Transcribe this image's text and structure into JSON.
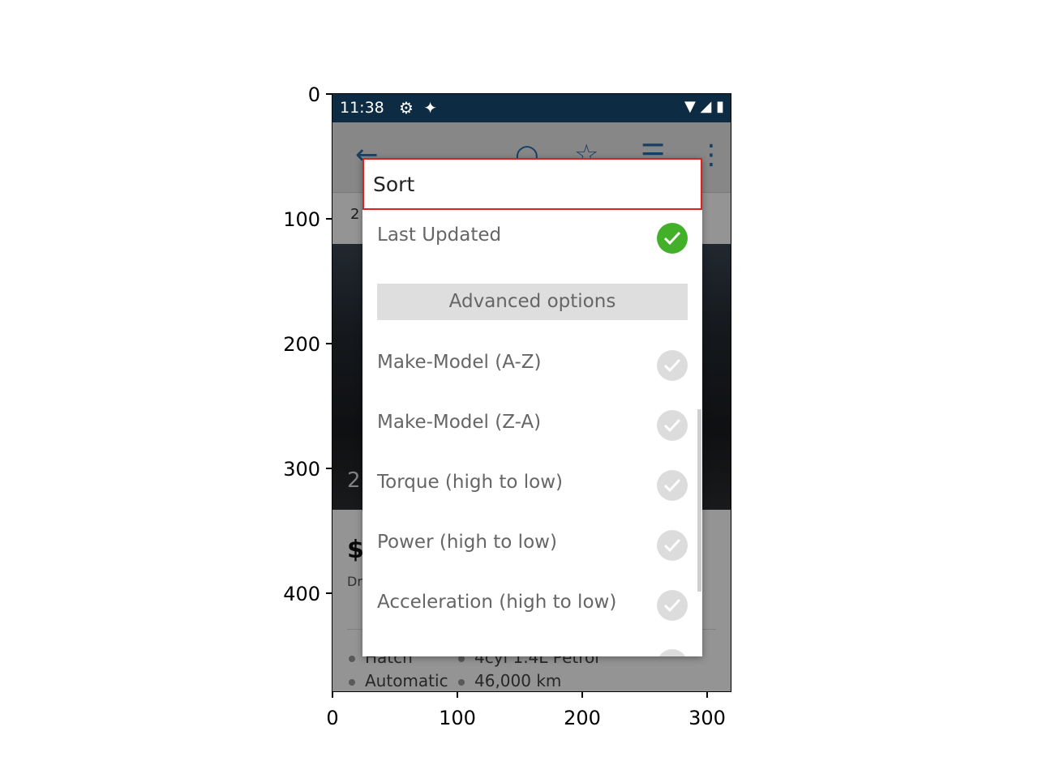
{
  "axes": {
    "y_ticks": [
      "0",
      "100",
      "200",
      "300",
      "400"
    ],
    "x_ticks": [
      "0",
      "100",
      "200",
      "300"
    ]
  },
  "statusbar": {
    "time": "11:38",
    "left_icons": [
      "gear-icon",
      "butterfly-icon"
    ],
    "right_icons": [
      "wifi-icon",
      "signal-icon",
      "battery-icon"
    ]
  },
  "appbar": {
    "icons": [
      "back-arrow-icon",
      "search-icon",
      "star-icon",
      "list-icon",
      "more-icon"
    ]
  },
  "background_listing": {
    "crumb": "2",
    "photo_count": "2",
    "price": "$",
    "dealer": "Dr",
    "specs": [
      "Hatch",
      "4cyl 1.4L Petrol",
      "Automatic",
      "46,000 km"
    ]
  },
  "dialog": {
    "title": "Sort",
    "primary_option": {
      "label": "Last Updated",
      "selected": true
    },
    "advanced_header": "Advanced options",
    "options": [
      {
        "label": "Make-Model (A-Z)",
        "selected": false
      },
      {
        "label": "Make-Model (Z-A)",
        "selected": false
      },
      {
        "label": "Torque (high to low)",
        "selected": false
      },
      {
        "label": "Power (high to low)",
        "selected": false
      },
      {
        "label": "Acceleration (high to low)",
        "selected": false
      }
    ]
  },
  "colors": {
    "statusbar": "#0d2c44",
    "selected_check": "#43b02a",
    "unselected_check": "#dcdcdc",
    "highlight_box": "#e0201f"
  }
}
